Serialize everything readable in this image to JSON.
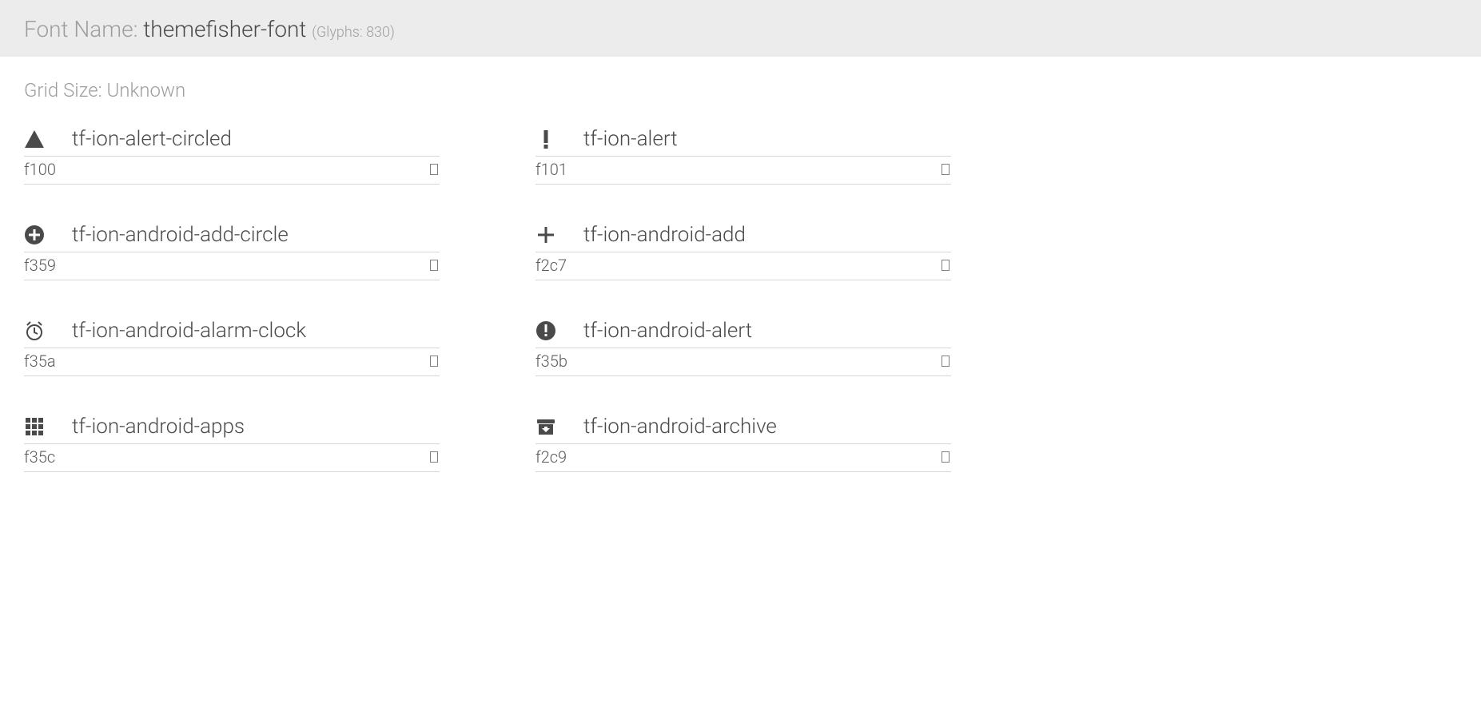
{
  "header": {
    "label": "Font Name: ",
    "font_name": "themefisher-font",
    "glyphs_label": "(Glyphs: 830)"
  },
  "grid_size": {
    "label": "Grid Size: ",
    "value": "Unknown"
  },
  "glyphs": [
    {
      "icon": "alert-triangle",
      "name": "tf-ion-alert-circled",
      "code": "f100"
    },
    {
      "icon": "exclamation",
      "name": "tf-ion-alert",
      "code": "f101"
    },
    {
      "icon": "plus-circle-filled",
      "name": "tf-ion-android-add-circle",
      "code": "f359"
    },
    {
      "icon": "plus",
      "name": "tf-ion-android-add",
      "code": "f2c7"
    },
    {
      "icon": "alarm-clock",
      "name": "tf-ion-android-alarm-clock",
      "code": "f35a"
    },
    {
      "icon": "exclaim-circle-fill",
      "name": "tf-ion-android-alert",
      "code": "f35b"
    },
    {
      "icon": "apps-grid",
      "name": "tf-ion-android-apps",
      "code": "f35c"
    },
    {
      "icon": "archive",
      "name": "tf-ion-android-archive",
      "code": "f2c9"
    }
  ]
}
